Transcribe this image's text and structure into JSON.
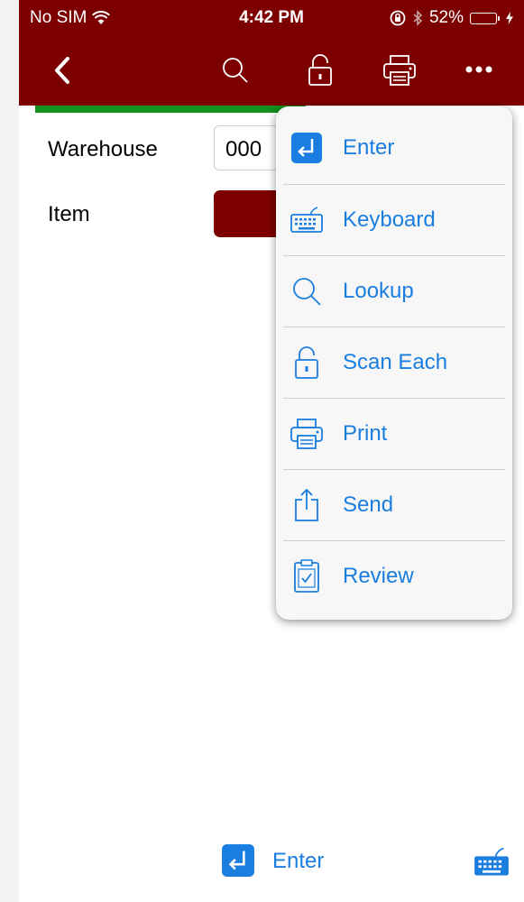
{
  "status_bar": {
    "carrier": "No SIM",
    "time": "4:42 PM",
    "battery_percent": "52%",
    "battery_level": 0.52,
    "icons": [
      "wifi-icon",
      "orientation-lock-icon",
      "bluetooth-icon",
      "battery-icon",
      "charging-icon"
    ]
  },
  "nav": {
    "icons": [
      "back-chevron-icon",
      "search-icon",
      "unlock-icon",
      "printer-icon",
      "more-icon"
    ]
  },
  "form": {
    "warehouse_label": "Warehouse",
    "warehouse_value": "000",
    "item_label": "Item"
  },
  "menu": {
    "items": [
      {
        "label": "Enter",
        "icon": "enter-icon"
      },
      {
        "label": "Keyboard",
        "icon": "keyboard-icon"
      },
      {
        "label": "Lookup",
        "icon": "search-icon"
      },
      {
        "label": "Scan Each",
        "icon": "unlock-icon"
      },
      {
        "label": "Print",
        "icon": "printer-icon"
      },
      {
        "label": "Send",
        "icon": "share-icon"
      },
      {
        "label": "Review",
        "icon": "clipboard-check-icon"
      }
    ]
  },
  "bottom_bar": {
    "enter_label": "Enter",
    "icons": [
      "enter-icon",
      "keyboard-icon"
    ]
  },
  "colors": {
    "header": "#7d0000",
    "accent": "#1a7ee0",
    "status_green": "#14901e",
    "battery_fill": "#2bd54b"
  }
}
